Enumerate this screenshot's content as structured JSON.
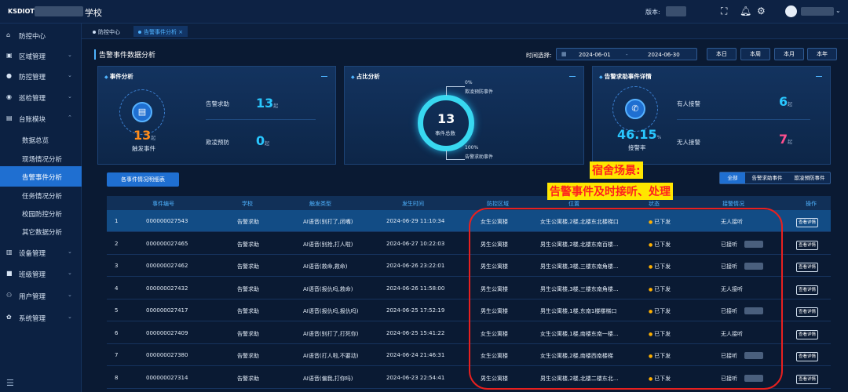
{
  "topbar": {
    "logo": "KSDIOT",
    "school": "学校",
    "version_label": "版本:",
    "icons": [
      "expand-icon",
      "bell-icon",
      "settings-icon"
    ],
    "user_caret": "⌄"
  },
  "sidebar": {
    "items": [
      {
        "icon": "home-icon",
        "label": "防控中心"
      },
      {
        "icon": "region-icon",
        "label": "区域管理"
      },
      {
        "icon": "location-icon",
        "label": "防控管理"
      },
      {
        "icon": "patrol-icon",
        "label": "巡检管理"
      },
      {
        "icon": "ledger-icon",
        "label": "台账模块"
      },
      {
        "label": "数据总览"
      },
      {
        "label": "现场情况分析"
      },
      {
        "label": "告警事件分析"
      },
      {
        "label": "任务情况分析"
      },
      {
        "label": "校园防控分析"
      },
      {
        "label": "其它数据分析"
      },
      {
        "icon": "device-icon",
        "label": "设备管理"
      },
      {
        "icon": "class-icon",
        "label": "班级管理"
      },
      {
        "icon": "user-icon",
        "label": "用户管理"
      },
      {
        "icon": "system-icon",
        "label": "系统管理"
      }
    ]
  },
  "tabs": [
    {
      "label": "防控中心"
    },
    {
      "label": "告警事件分析",
      "close": "×"
    }
  ],
  "header": {
    "title": "告警事件数据分析",
    "time_label": "时间选择:",
    "start_date": "2024-06-01",
    "separator": "-",
    "end_date": "2024-06-30",
    "quick_buttons": [
      "本日",
      "本周",
      "本月",
      "本年"
    ]
  },
  "event_panel": {
    "title": "事件分析",
    "total_value": "13",
    "unit": "起",
    "total_label": "触发事件",
    "alarm_label": "告警求助",
    "alarm_value": "13",
    "bully_label": "欺凌预防",
    "bully_value": "0"
  },
  "ratio_panel": {
    "title": "占比分析",
    "center_value": "13",
    "center_label": "事件总数",
    "top_pct": "0%",
    "top_label": "欺凌预防事件",
    "bottom_pct": "100%",
    "bottom_label": "告警求助事件"
  },
  "rescue_panel": {
    "title": "告警求助事件详情",
    "rate_value": "46.15",
    "rate_unit": "%",
    "rate_label": "接警率",
    "answered_label": "有人接警",
    "answered_value": "6",
    "unanswered_label": "无人接警",
    "unanswered_value": "7",
    "unit": "起"
  },
  "detail": {
    "subsection_label": "各事件情况明细表",
    "filters": [
      "全部",
      "告警求助事件",
      "欺凌预防事件"
    ],
    "callout_line1": "宿舍场景:",
    "callout_line2": "告警事件及时接听、处理",
    "columns": [
      "事件编号",
      "学校",
      "触发类型",
      "发生时间",
      "防控区域",
      "位置",
      "状态",
      "接警情况",
      "操作"
    ],
    "rows": [
      {
        "no": "1",
        "id": "000000027543",
        "type": "告警求助",
        "trigger": "AI语音(别打了,闭嘴)",
        "time": "2024-06-29 11:10:34",
        "zone": "女生公寓楼",
        "loc": "女生公寓楼,2楼,北楼东北楼梯口",
        "status": "已下发",
        "handler": "无人接听",
        "action": "查看详情"
      },
      {
        "no": "2",
        "id": "000000027465",
        "type": "告警求助",
        "trigger": "AI语音(别抢,打人啦)",
        "time": "2024-06-27 10:22:03",
        "zone": "男生公寓楼",
        "loc": "男生公寓楼,2楼,北楼东南百楼...",
        "status": "已下发",
        "handler": "已接听",
        "action": "查看详情"
      },
      {
        "no": "3",
        "id": "000000027462",
        "type": "告警求助",
        "trigger": "AI语音(救命,救命)",
        "time": "2024-06-26 23:22:01",
        "zone": "男生公寓楼",
        "loc": "男生公寓楼,3楼,三楼东南角楼...",
        "status": "已下发",
        "handler": "已接听",
        "action": "查看详情"
      },
      {
        "no": "4",
        "id": "000000027432",
        "type": "告警求助",
        "trigger": "AI语音(报仇吗,救命)",
        "time": "2024-06-26 11:58:00",
        "zone": "男生公寓楼",
        "loc": "男生公寓楼,3楼,三楼东南角楼...",
        "status": "已下发",
        "handler": "无人接听",
        "action": "查看详情"
      },
      {
        "no": "5",
        "id": "000000027417",
        "type": "告警求助",
        "trigger": "AI语音(报仇吗,报仇吗)",
        "time": "2024-06-25 17:52:19",
        "zone": "男生公寓楼",
        "loc": "男生公寓楼,1楼,东南1楼楼梯口",
        "status": "已下发",
        "handler": "已接听",
        "action": "查看详情"
      },
      {
        "no": "6",
        "id": "000000027409",
        "type": "告警求助",
        "trigger": "AI语音(别打了,打死你)",
        "time": "2024-06-25 15:41:22",
        "zone": "女生公寓楼",
        "loc": "女生公寓楼,1楼,南楼东南一楼...",
        "status": "已下发",
        "handler": "无人接听",
        "action": "查看详情"
      },
      {
        "no": "7",
        "id": "000000027380",
        "type": "告警求助",
        "trigger": "AI语音(打人啦,不要动)",
        "time": "2024-06-24 21:46:31",
        "zone": "女生公寓楼",
        "loc": "女生公寓楼,2楼,南楼西南楼梯",
        "status": "已下发",
        "handler": "已接听",
        "action": "查看详情"
      },
      {
        "no": "8",
        "id": "000000027314",
        "type": "告警求助",
        "trigger": "AI语音(偏我,打你吗)",
        "time": "2024-06-23 22:54:41",
        "zone": "男生公寓楼",
        "loc": "男生公寓楼,2楼,北楼二楼东北...",
        "status": "已下发",
        "handler": "已接听",
        "action": "查看详情"
      }
    ]
  },
  "colors": {
    "accent": "#1f6fd1",
    "orange": "#ff8c1a",
    "cyan": "#29c7ff",
    "pink": "#ff4f8e",
    "highlight": "#ffe600",
    "annotation_red": "#e8201f"
  }
}
